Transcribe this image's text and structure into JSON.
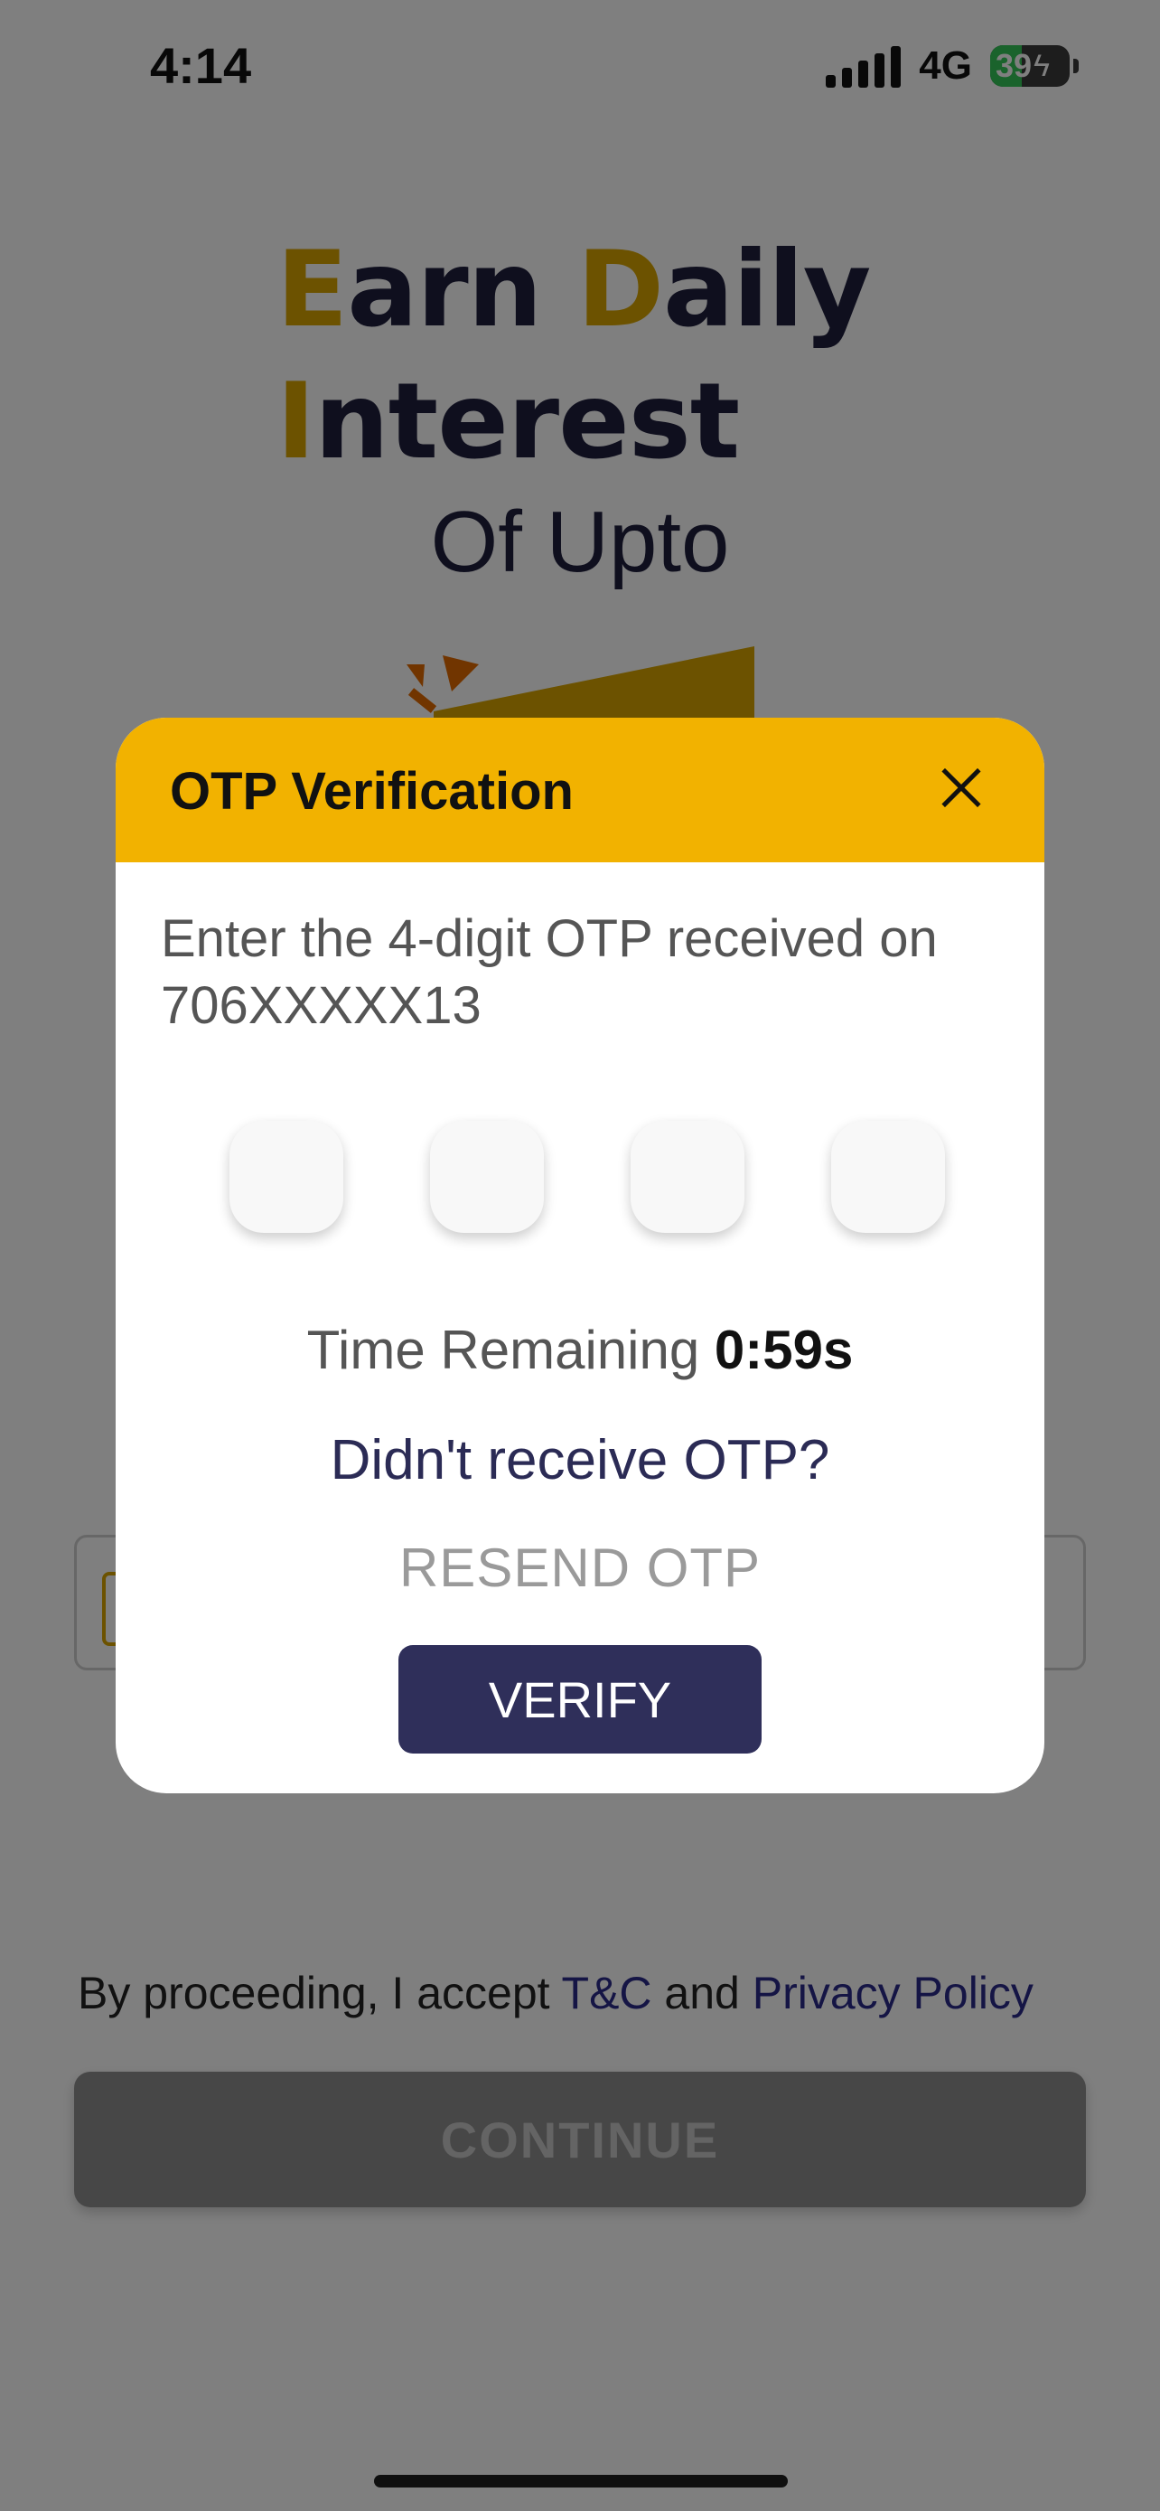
{
  "status_bar": {
    "time": "4:14",
    "network": "4G",
    "battery": "39"
  },
  "hero": {
    "line1_a": "E",
    "line1_b": "arn ",
    "line1_c": "D",
    "line1_d": "aily",
    "line2_a": "I",
    "line2_b": "nterest",
    "line3": "Of Upto"
  },
  "terms": {
    "prefix": "By proceeding, I accept ",
    "tc": "T&C",
    "middle": " and ",
    "privacy": "Privacy Policy"
  },
  "continue_label": "CONTINUE",
  "modal": {
    "title": "OTP Verification",
    "instruction": "Enter the 4-digit OTP received on 706XXXXX13",
    "time_label": "Time Remaining ",
    "time_value": "0:59s",
    "didnt_receive": "Didn't receive OTP?",
    "resend": "RESEND OTP",
    "verify": "VERIFY"
  },
  "colors": {
    "accent": "#f2b200",
    "brand_dark": "#2f2f5a",
    "gold": "#d9a500"
  },
  "icons": [
    "signal-icon",
    "battery-icon",
    "close-icon",
    "phone-icon"
  ]
}
